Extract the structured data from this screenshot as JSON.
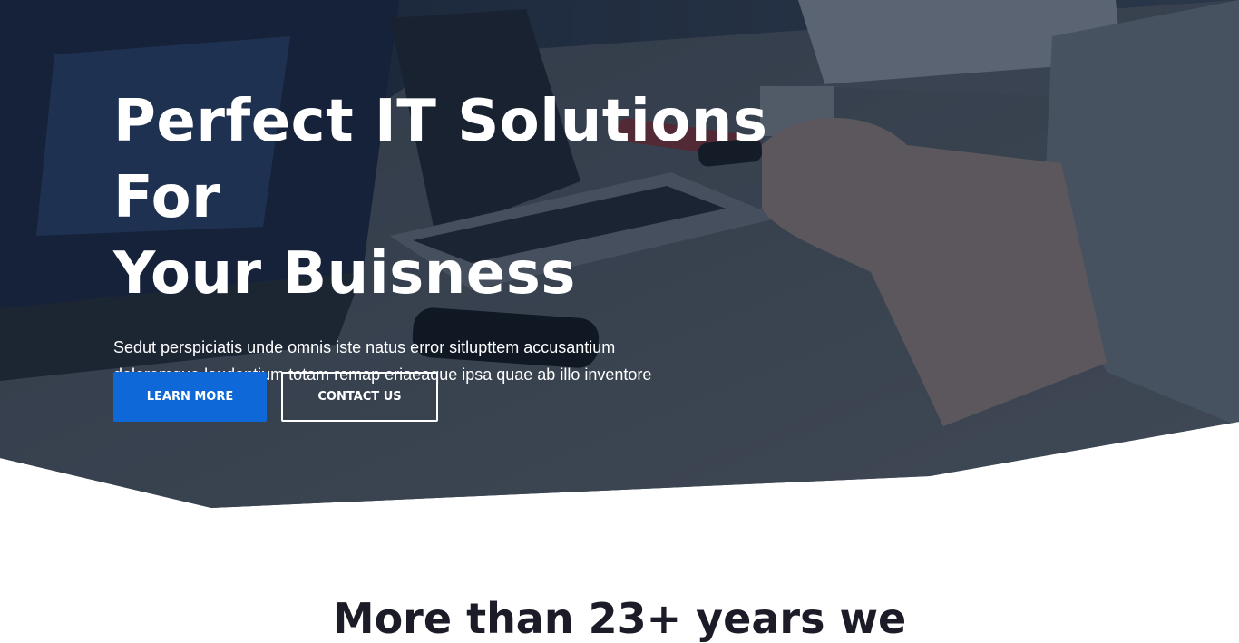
{
  "hero": {
    "title_line1": "Perfect IT Solutions For",
    "title_line2": "Your Buisness",
    "description": "Sedut perspiciatis unde omnis iste natus error sitlupttem accusantium doloremque laudantium totam remap eriaeaque ipsa quae ab illo inventore veritatis",
    "learn_more_label": "LEARN MORE",
    "contact_label": "CONTACT US",
    "background_image": "office-laptops-photo",
    "overlay_color": "#0f1c30"
  },
  "next_section": {
    "heading": "More than 23+ years we"
  },
  "colors": {
    "primary": "#0f68d7",
    "text_dark": "#1c1c28",
    "white": "#ffffff"
  }
}
